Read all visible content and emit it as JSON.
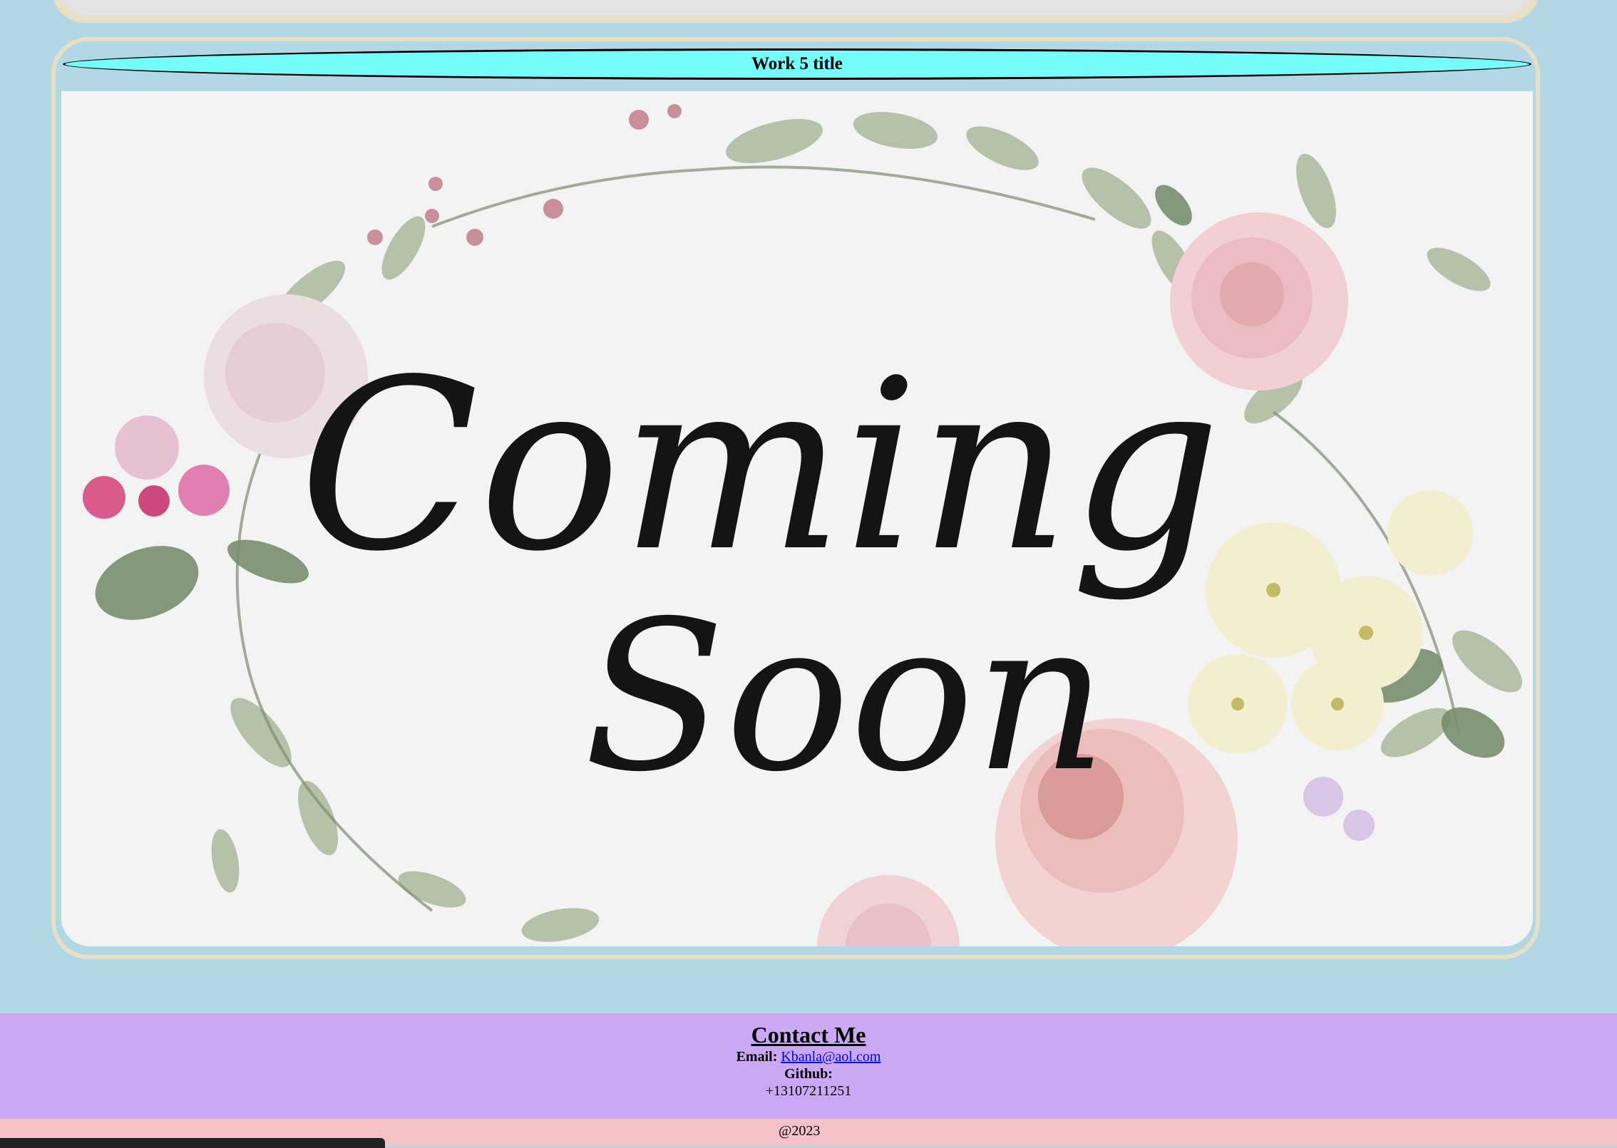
{
  "work": {
    "title": "Work 5 title",
    "image_text_line1": "Coming",
    "image_text_line2": "Soon"
  },
  "contact": {
    "heading": "Contact Me",
    "email_label": "Email:",
    "email_value": "Kbanla@aol.com",
    "github_label": "Github:",
    "phone": "+13107211251"
  },
  "footer": {
    "copyright": "@2023"
  },
  "colors": {
    "page_background": "#b3d8e5",
    "title_pill": "#76fbfb",
    "card_border": "#e8dfc4",
    "contact_background": "#cba8f3",
    "copyright_background": "#f3c1c6",
    "link": "#0000ee"
  }
}
